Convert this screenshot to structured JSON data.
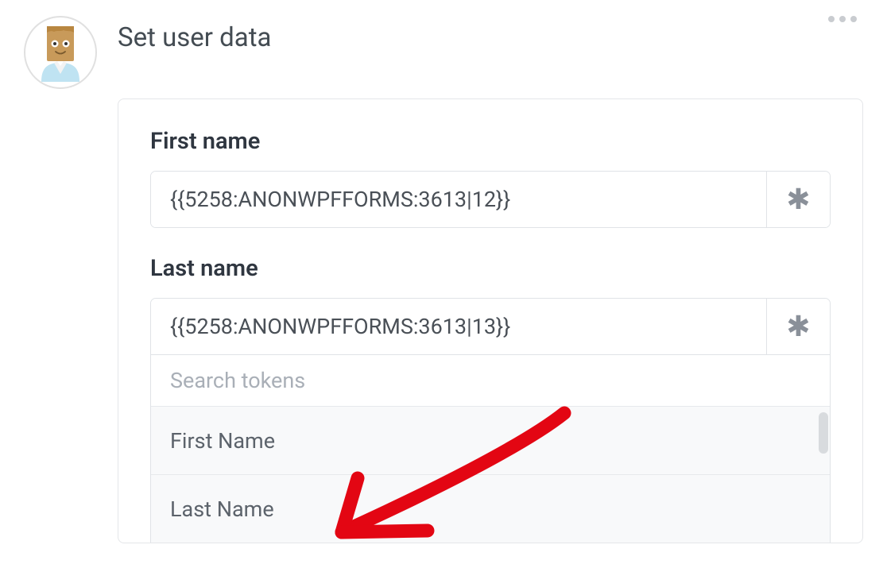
{
  "title": "Set user data",
  "fields": {
    "first_name": {
      "label": "First name",
      "value": "{{5258:ANONWPFFORMS:3613|12}}"
    },
    "last_name": {
      "label": "Last name",
      "value": "{{5258:ANONWPFFORMS:3613|13}}"
    }
  },
  "token_dropdown": {
    "search_placeholder": "Search tokens",
    "options": [
      "First Name",
      "Last Name"
    ]
  },
  "icons": {
    "asterisk": "✱"
  },
  "annotation": {
    "arrow_color": "#e30613"
  }
}
